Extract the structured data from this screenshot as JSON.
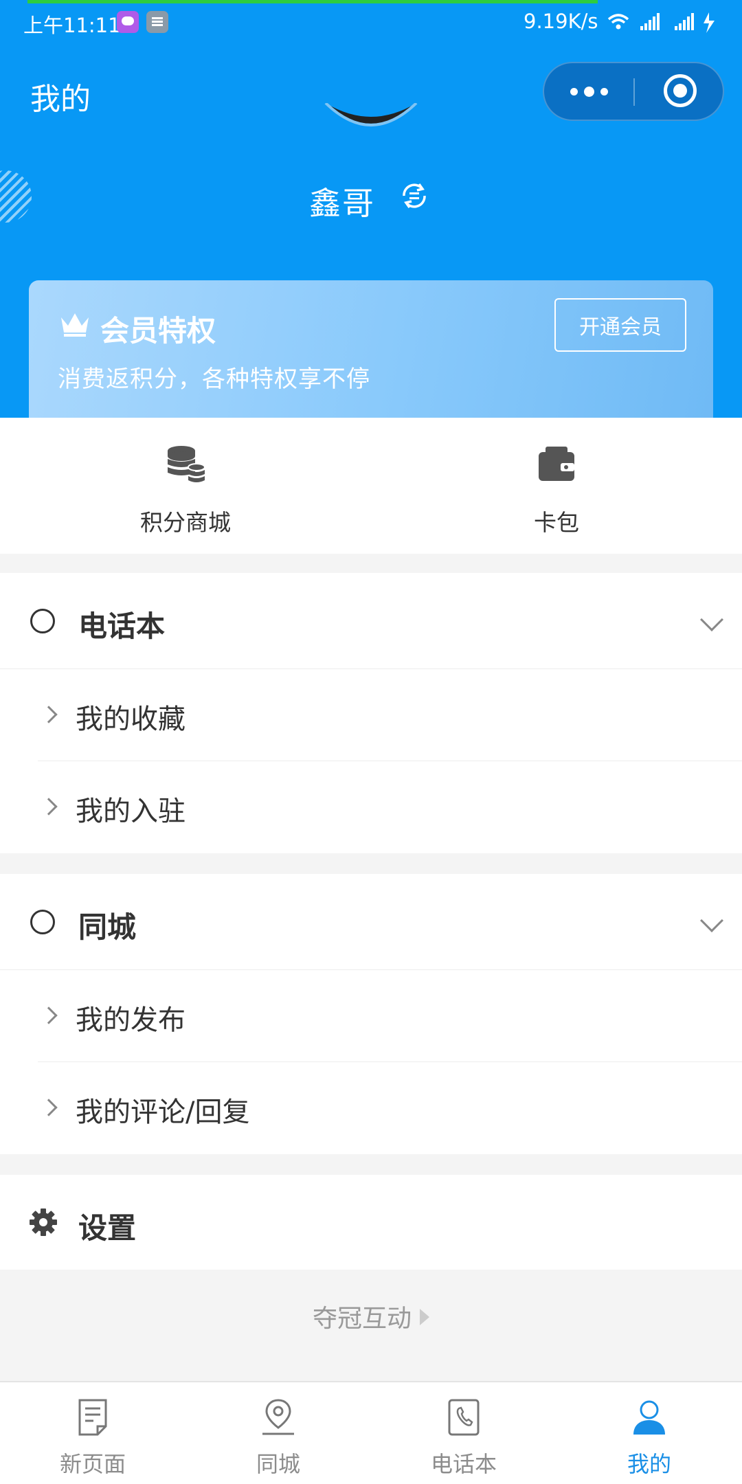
{
  "status_bar": {
    "time": "上午11:11",
    "net_speed": "9.19K/s"
  },
  "header": {
    "title": "我的",
    "more_icon": "more-dots-icon",
    "close_icon": "target-close-icon"
  },
  "profile": {
    "nickname": "鑫哥",
    "switch_icon": "refresh-switch-icon"
  },
  "vip_card": {
    "title": "会员特权",
    "subtitle": "消费返积分，各种特权享不停",
    "button": "开通会员",
    "icon": "crown-icon"
  },
  "quick_entries": [
    {
      "label": "积分商城",
      "icon": "coins-stack-icon"
    },
    {
      "label": "卡包",
      "icon": "wallet-icon"
    }
  ],
  "sections": [
    {
      "title": "电话本",
      "items": [
        {
          "label": "我的收藏"
        },
        {
          "label": "我的入驻"
        }
      ]
    },
    {
      "title": "同城",
      "items": [
        {
          "label": "我的发布"
        },
        {
          "label": "我的评论/回复"
        }
      ]
    }
  ],
  "settings": {
    "label": "设置",
    "icon": "gear-icon"
  },
  "footer": {
    "brand": "夺冠互动"
  },
  "tabbar": {
    "active_index": 3,
    "items": [
      {
        "label": "新页面",
        "icon": "document-icon"
      },
      {
        "label": "同城",
        "icon": "location-pin-icon"
      },
      {
        "label": "电话本",
        "icon": "phone-book-icon"
      },
      {
        "label": "我的",
        "icon": "user-icon"
      }
    ]
  },
  "colors": {
    "primary_blue": "#0898f5",
    "tab_active": "#1a8fe6",
    "text_dark": "#333333",
    "background_gray": "#f4f4f4"
  }
}
